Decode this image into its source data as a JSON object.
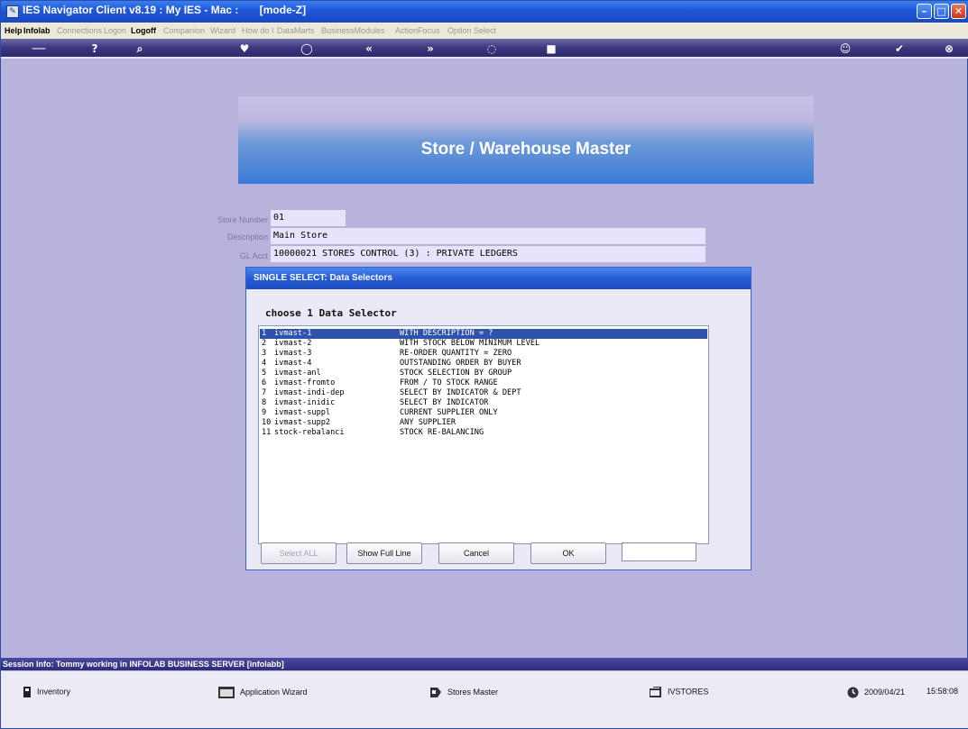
{
  "window": {
    "title": "IES Navigator Client v8.19 : My IES - Mac :       [mode-Z]",
    "min": "–",
    "max": "□",
    "close": "✕"
  },
  "menu": {
    "help": "Help",
    "infolab": "Infolab",
    "connections": "Connections",
    "logon": "Logon",
    "logoff": "Logoff",
    "companion": "Companion",
    "wizard": "Wizard",
    "howdoi": "How do I",
    "datamarts": "DataMarts",
    "businessmodules": "BusinessModules",
    "actionfocus": "ActionFocus",
    "optionselect": "Option Select"
  },
  "toolbar": {
    "icons": [
      "key-icon",
      "help-icon",
      "search-icon",
      "heart-icon",
      "clock-icon",
      "rewind-icon",
      "forward-icon",
      "expand-icon",
      "stop-icon",
      "smiley-icon",
      "check-icon",
      "close-icon"
    ],
    "glyphs": [
      "──",
      "?",
      "⌕",
      "♥",
      "◯",
      "«",
      "»",
      "◌",
      "■",
      "☺",
      "✔",
      "⊗"
    ]
  },
  "banner": {
    "title": "Store / Warehouse Master"
  },
  "form": {
    "store_label": "Store Number",
    "store_value": "01",
    "desc_label": "Description",
    "desc_value": "Main Store",
    "gl_label": "GL Acct",
    "gl_value": "10000021 STORES CONTROL (3) : PRIVATE LEDGERS"
  },
  "dialog": {
    "title": "SINGLE SELECT: Data Selectors",
    "prompt": "choose 1 Data Selector",
    "rows": [
      {
        "num": "1",
        "code": "ivmast-1",
        "desc": "WITH DESCRIPTION = ?"
      },
      {
        "num": "2",
        "code": "ivmast-2",
        "desc": "WITH STOCK BELOW MINIMUM LEVEL"
      },
      {
        "num": "3",
        "code": "ivmast-3",
        "desc": "RE-ORDER QUANTITY = ZERO"
      },
      {
        "num": "4",
        "code": "ivmast-4",
        "desc": "OUTSTANDING ORDER BY BUYER"
      },
      {
        "num": "5",
        "code": "ivmast-anl",
        "desc": "STOCK SELECTION BY GROUP"
      },
      {
        "num": "6",
        "code": "ivmast-fromto",
        "desc": "FROM / TO STOCK RANGE"
      },
      {
        "num": "7",
        "code": "ivmast-indi-dep",
        "desc": "SELECT BY INDICATOR & DEPT"
      },
      {
        "num": "8",
        "code": "ivmast-inidic",
        "desc": "SELECT BY INDICATOR"
      },
      {
        "num": "9",
        "code": "ivmast-suppl",
        "desc": "CURRENT SUPPLIER ONLY"
      },
      {
        "num": "10",
        "code": "ivmast-supp2",
        "desc": "ANY SUPPLIER"
      },
      {
        "num": "11",
        "code": "stock-rebalanci",
        "desc": "STOCK RE-BALANCING"
      }
    ],
    "buttons": {
      "select_all": "Select ALL",
      "show_full": "Show Full Line",
      "cancel": "Cancel",
      "ok": "OK"
    },
    "input_value": ""
  },
  "session": {
    "info": "Session Info: Tommy working in INFOLAB BUSINESS SERVER  [infolabb]"
  },
  "status": {
    "inventory": "Inventory",
    "app_wizard": "Application Wizard",
    "stores_master": "Stores Master",
    "ivstores": "IVSTORES",
    "date": "2009/04/21",
    "time": "15:58:08"
  }
}
